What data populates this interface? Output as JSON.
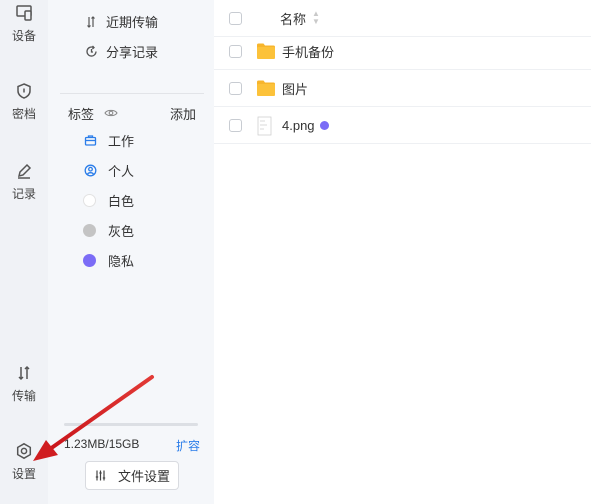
{
  "rail": {
    "devices": "设备",
    "vault": "密档",
    "records": "记录",
    "transfer": "传输",
    "settings": "设置"
  },
  "sidebar": {
    "recent_transfers": "近期传输",
    "share_records": "分享记录",
    "tags_title": "标签",
    "tags_add": "添加",
    "tags": [
      {
        "label": "工作",
        "color": "#2b7de9",
        "icon": "briefcase-icon"
      },
      {
        "label": "个人",
        "color": "#2b7de9",
        "icon": "person-icon"
      },
      {
        "label": "白色",
        "color": "#ffffff"
      },
      {
        "label": "灰色",
        "color": "#c4c4c4"
      },
      {
        "label": "隐私",
        "color": "#7b6cf6"
      }
    ],
    "storage": {
      "text": "1.23MB/15GB",
      "expand": "扩容",
      "used_fraction": 0.0001
    },
    "file_settings": "文件设置"
  },
  "main": {
    "name_header": "名称",
    "files": [
      {
        "name": "手机备份",
        "type": "folder"
      },
      {
        "name": "图片",
        "type": "folder"
      },
      {
        "name": "4.png",
        "type": "image",
        "tag_color": "#7b6cf6"
      }
    ]
  },
  "colors": {
    "accent": "#2b7de9",
    "folder": "#f7b52c",
    "annotation_arrow": "#e02020"
  }
}
